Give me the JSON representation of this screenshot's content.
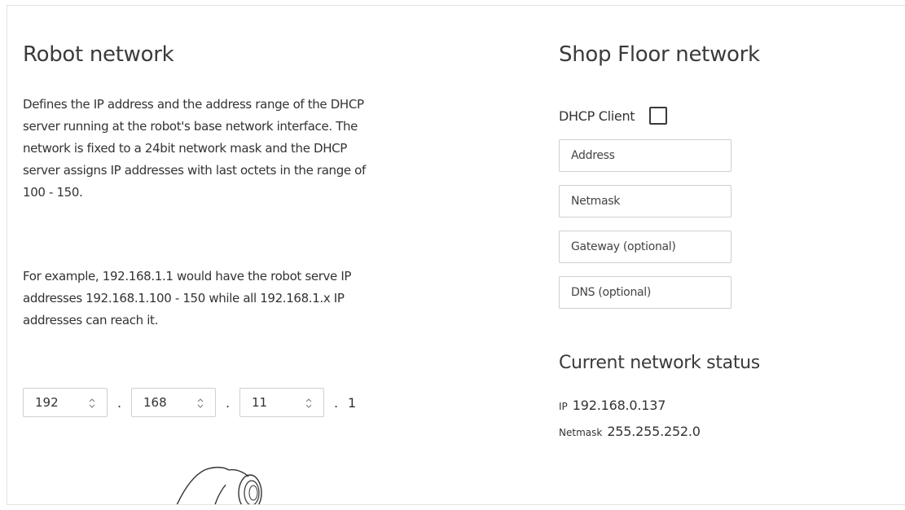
{
  "robot_network": {
    "title": "Robot network",
    "description_1": "Defines the IP address and the address range of the DHCP server running at the robot's base network interface. The network is fixed to a 24bit network mask and the DHCP server assigns IP addresses with last octets in the range of 100 - 150.",
    "description_2": "For example, 192.168.1.1 would have the robot serve IP addresses 192.168.1.100 - 150 while all 192.168.1.x IP addresses can reach it.",
    "octets": [
      "192",
      "168",
      "11"
    ],
    "separator": ".",
    "last_octet": "1"
  },
  "shop_floor_network": {
    "title": "Shop Floor network",
    "dhcp_client_label": "DHCP Client",
    "dhcp_client_checked": false,
    "address_placeholder": "Address",
    "netmask_placeholder": "Netmask",
    "gateway_placeholder": "Gateway (optional)",
    "dns_placeholder": "DNS (optional)"
  },
  "current_status": {
    "title": "Current network status",
    "ip_label": "IP",
    "ip_value": "192.168.0.137",
    "netmask_label": "Netmask",
    "netmask_value": "255.255.252.0"
  },
  "icons": {
    "stepper": "up-down-chevron-icon",
    "robot": "robot-arm-icon"
  }
}
